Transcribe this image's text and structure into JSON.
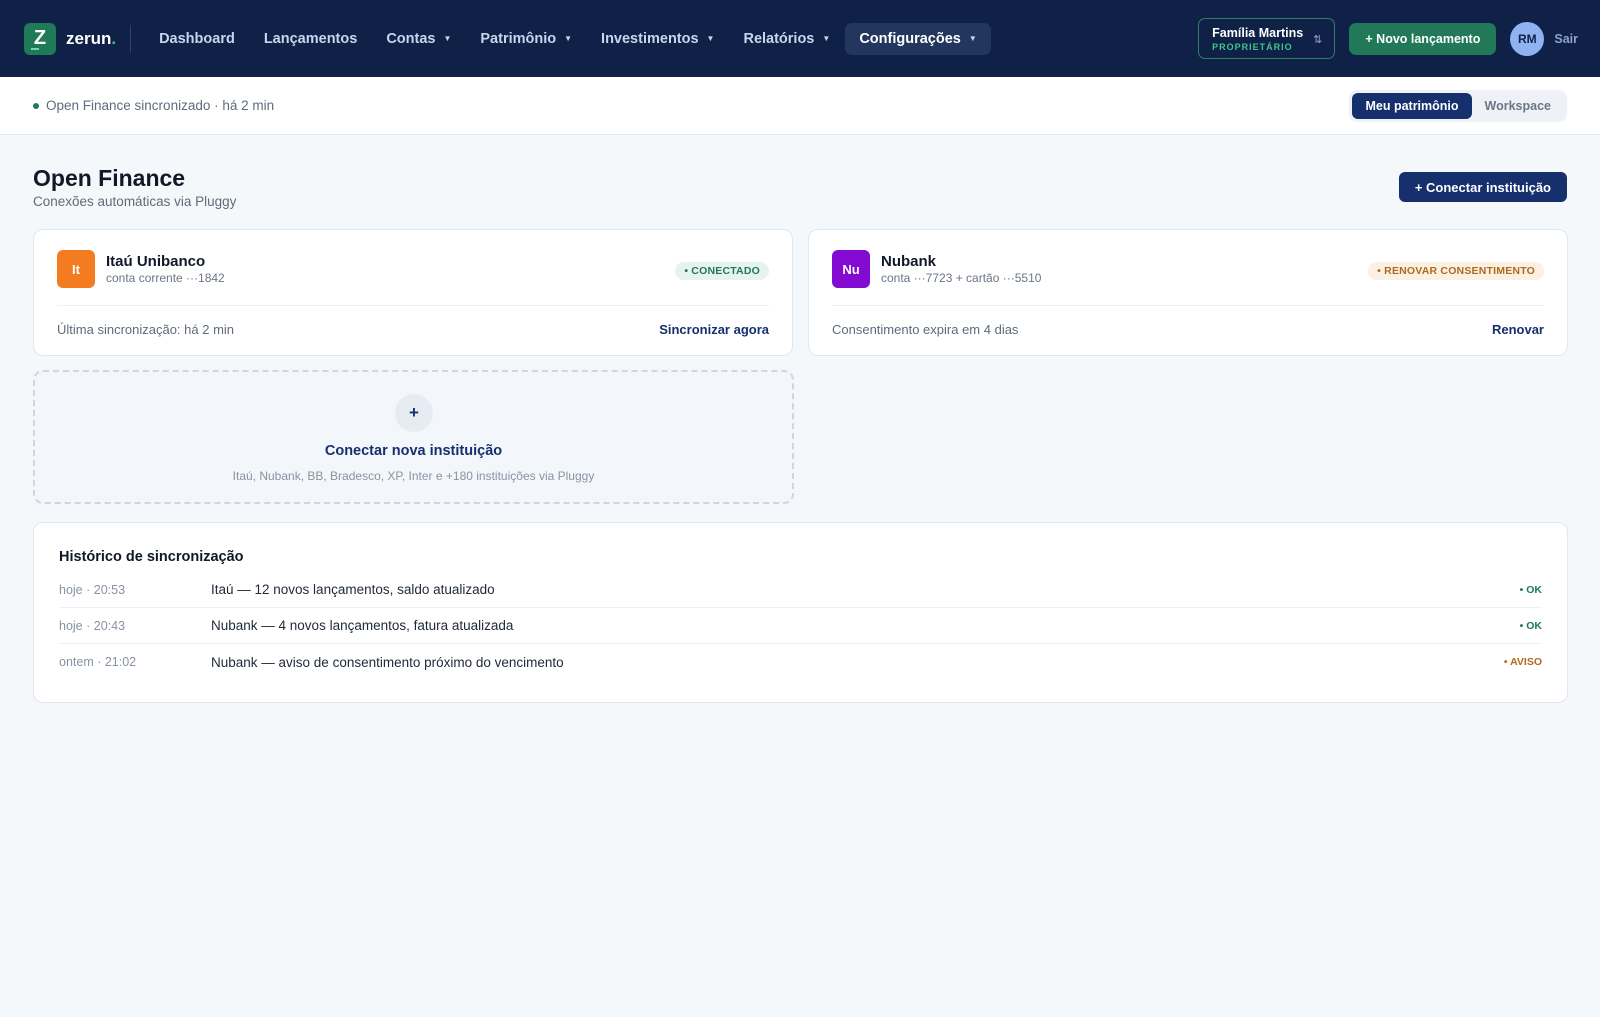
{
  "brand": {
    "logo_letter": "Z",
    "name": "zerun",
    "dot": "."
  },
  "nav": {
    "items": [
      {
        "label": "Dashboard",
        "has_caret": false,
        "active": false
      },
      {
        "label": "Lançamentos",
        "has_caret": false,
        "active": false
      },
      {
        "label": "Contas",
        "has_caret": true,
        "active": false
      },
      {
        "label": "Patrimônio",
        "has_caret": true,
        "active": false
      },
      {
        "label": "Investimentos",
        "has_caret": true,
        "active": false
      },
      {
        "label": "Relatórios",
        "has_caret": true,
        "active": false
      },
      {
        "label": "Configurações",
        "has_caret": true,
        "active": true
      }
    ],
    "family": {
      "name": "Família Martins",
      "role": "PROPRIETÁRIO",
      "swap_icon": "⇅"
    },
    "new_entry_label": "+ Novo lançamento",
    "avatar_initials": "RM",
    "logout_label": "Sair"
  },
  "subbar": {
    "sync_status": "Open Finance sincronizado · há 2 min",
    "toggle": {
      "options": [
        "Meu patrimônio",
        "Workspace"
      ],
      "selected": "Meu patrimônio"
    }
  },
  "page": {
    "title": "Open Finance",
    "subtitle": "Conexões automáticas via Pluggy",
    "connect_button": "+ Conectar instituição"
  },
  "institutions": [
    {
      "logo": "It",
      "logo_color": "#f47b20",
      "name": "Itaú Unibanco",
      "account": "conta corrente ···1842",
      "status": "• CONECTADO",
      "status_kind": "ok",
      "footer_text": "Última sincronização: há 2 min",
      "action": "Sincronizar agora"
    },
    {
      "logo": "Nu",
      "logo_color": "#820ad1",
      "name": "Nubank",
      "account": "conta ···7723 + cartão ···5510",
      "status": "• RENOVAR CONSENTIMENTO",
      "status_kind": "warn",
      "footer_text": "Consentimento expira em 4 dias",
      "action": "Renovar"
    }
  ],
  "add_institution": {
    "plus": "+",
    "title": "Conectar nova instituição",
    "subtitle": "Itaú, Nubank, BB, Bradesco, XP, Inter e +180 instituições via Pluggy"
  },
  "history": {
    "title": "Histórico de sincronização",
    "rows": [
      {
        "when": "hoje · 20:53",
        "message": "Itaú — 12 novos lançamentos, saldo atualizado",
        "status": "• OK",
        "kind": "ok"
      },
      {
        "when": "hoje · 20:43",
        "message": "Nubank — 4 novos lançamentos, fatura atualizada",
        "status": "• OK",
        "kind": "ok"
      },
      {
        "when": "ontem · 21:02",
        "message": "Nubank — aviso de consentimento próximo do vencimento",
        "status": "• AVISO",
        "kind": "warn"
      }
    ]
  },
  "colors": {
    "navy": "#0f2147",
    "primary": "#16306e",
    "green": "#22795a",
    "ok": "#1f7a57",
    "warn": "#b06a1c"
  }
}
